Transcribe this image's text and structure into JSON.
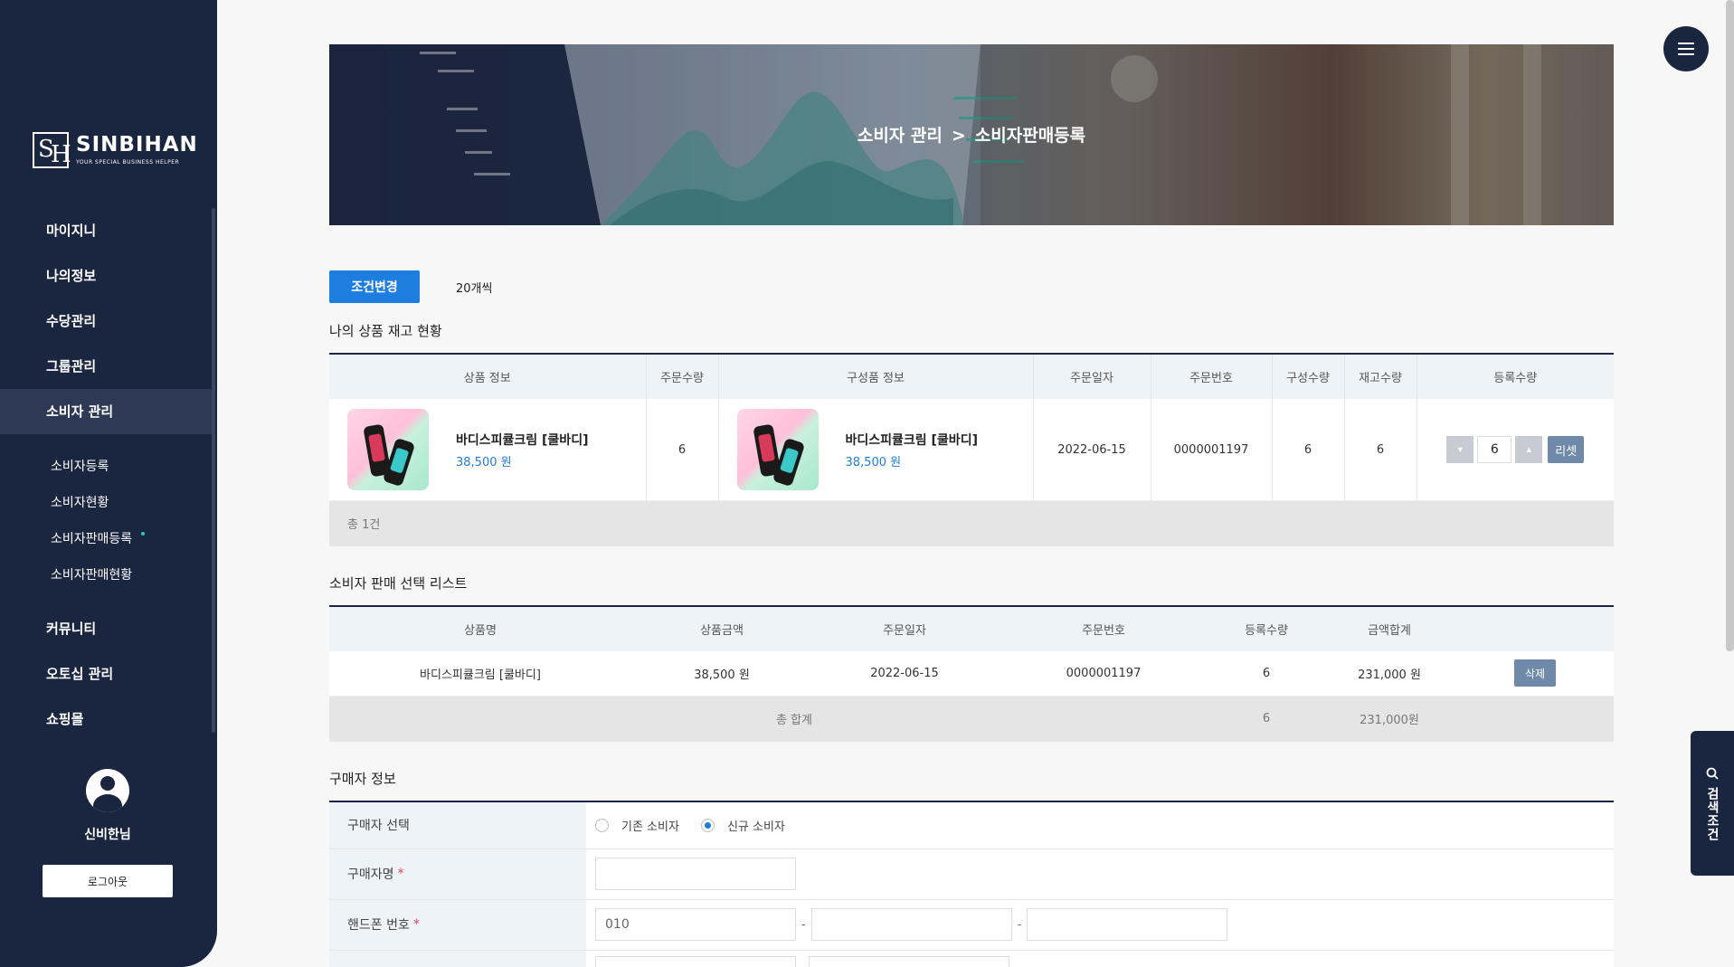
{
  "brand": {
    "name": "SINBIHAN",
    "tagline": "YOUR SPECIAL BUSINESS HELPER",
    "mark_letters": [
      "S",
      "H"
    ]
  },
  "sidebar": {
    "items": [
      {
        "label": "마이지니"
      },
      {
        "label": "나의정보"
      },
      {
        "label": "수당관리"
      },
      {
        "label": "그룹관리"
      },
      {
        "label": "소비자 관리",
        "active": true
      }
    ],
    "subitems": [
      {
        "label": "소비자등록"
      },
      {
        "label": "소비자현황"
      },
      {
        "label": "소비자판매등록",
        "current": true
      },
      {
        "label": "소비자판매현황"
      }
    ],
    "items_after": [
      {
        "label": "커뮤니티"
      },
      {
        "label": "오토십 관리"
      },
      {
        "label": "쇼핑몰"
      }
    ],
    "user_name": "신비한님",
    "logout_label": "로그아웃"
  },
  "banner": {
    "crumb_parent": "소비자 관리",
    "crumb_sep": ">",
    "crumb_current": "소비자판매등록"
  },
  "controls": {
    "condition_button": "조건변경",
    "per_page": "20개씩"
  },
  "inventory": {
    "title": "나의 상품 재고 현황",
    "columns": [
      "상품 정보",
      "주문수량",
      "구성품 정보",
      "주문일자",
      "주문번호",
      "구성수량",
      "재고수량",
      "등록수량"
    ],
    "rows": [
      {
        "product_name": "바디스피큘크림 [쿨바디]",
        "product_price": "38,500 원",
        "order_qty": "6",
        "component_name": "바디스피큘크림 [쿨바디]",
        "component_price": "38,500 원",
        "order_date": "2022-06-15",
        "order_no": "0000001197",
        "component_qty": "6",
        "stock_qty": "6",
        "register_qty": "6"
      }
    ],
    "reset_label": "리셋",
    "total": "총 1건"
  },
  "selection": {
    "title": "소비자 판매 선택 리스트",
    "columns": [
      "상품명",
      "상품금액",
      "주문일자",
      "주문번호",
      "등록수량",
      "금액합계",
      ""
    ],
    "rows": [
      {
        "name": "바디스피큘크림 [쿨바디]",
        "price": "38,500 원",
        "order_date": "2022-06-15",
        "order_no": "0000001197",
        "qty": "6",
        "sum": "231,000 원"
      }
    ],
    "delete_label": "삭제",
    "footer": {
      "label": "총 합계",
      "qty": "6",
      "sum": "231,000원"
    }
  },
  "buyer": {
    "title": "구매자 정보",
    "select_label": "구매자 선택",
    "option_existing": "기존 소비자",
    "option_new": "신규 소비자",
    "selected": "new",
    "name_label": "구매자명",
    "name_value": "",
    "phone_label": "핸드폰 번호",
    "phone_prefix": "010",
    "phone_sep": "-",
    "required_mark": "*"
  },
  "search_tab_label": "검색조건",
  "colors": {
    "navy": "#1a2540",
    "primary": "#1e7ee0",
    "slate_button": "#6e8aa8",
    "required": "#e0455a"
  },
  "icons": [
    "menu-icon",
    "search-icon",
    "user-avatar-icon",
    "caret-down-icon",
    "caret-up-icon"
  ]
}
